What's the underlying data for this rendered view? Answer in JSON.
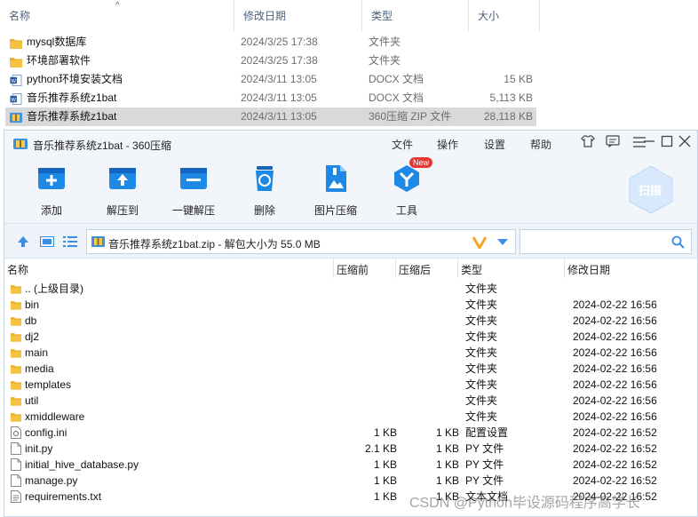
{
  "explorer": {
    "columns": {
      "name": "名称",
      "date": "修改日期",
      "type": "类型",
      "size": "大小"
    },
    "rows": [
      {
        "name": "mysql数据库",
        "date": "2024/3/25 17:38",
        "type": "文件夹",
        "size": "",
        "icon": "folder-icon"
      },
      {
        "name": "环境部署软件",
        "date": "2024/3/25 17:38",
        "type": "文件夹",
        "size": "",
        "icon": "folder-icon"
      },
      {
        "name": "python环境安装文档",
        "date": "2024/3/11 13:05",
        "type": "DOCX 文档",
        "size": "15 KB",
        "icon": "word-doc-icon"
      },
      {
        "name": "音乐推荐系统z1bat",
        "date": "2024/3/11 13:05",
        "type": "DOCX 文档",
        "size": "5,113 KB",
        "icon": "word-doc-icon"
      },
      {
        "name": "音乐推荐系统z1bat",
        "date": "2024/3/11 13:05",
        "type": "360压缩 ZIP 文件",
        "size": "28,118 KB",
        "icon": "zip-archive-icon",
        "selected": true
      }
    ]
  },
  "archiver": {
    "title": "音乐推荐系统z1bat - 360压缩",
    "menu": [
      "文件",
      "操作",
      "设置",
      "帮助"
    ],
    "toolbar": [
      {
        "label": "添加",
        "icon": "add-icon"
      },
      {
        "label": "解压到",
        "icon": "extract-to-icon"
      },
      {
        "label": "一键解压",
        "icon": "one-click-extract-icon"
      },
      {
        "label": "删除",
        "icon": "delete-icon"
      },
      {
        "label": "图片压缩",
        "icon": "image-compress-icon"
      },
      {
        "label": "工具",
        "icon": "tools-icon",
        "badge": "New"
      }
    ],
    "scan_label": "扫描",
    "address": "音乐推荐系统z1bat.zip - 解包大小为 55.0 MB",
    "search_placeholder": "",
    "columns": {
      "name": "名称",
      "compressed": "压缩前",
      "actual": "压缩后",
      "type": "类型",
      "date": "修改日期"
    },
    "files": [
      {
        "name": ".. (上级目录)",
        "c": "",
        "a": "",
        "type": "文件夹",
        "date": "",
        "icon": "folder-icon"
      },
      {
        "name": "bin",
        "c": "",
        "a": "",
        "type": "文件夹",
        "date": "2024-02-22 16:56",
        "icon": "folder-icon"
      },
      {
        "name": "db",
        "c": "",
        "a": "",
        "type": "文件夹",
        "date": "2024-02-22 16:56",
        "icon": "folder-icon"
      },
      {
        "name": "dj2",
        "c": "",
        "a": "",
        "type": "文件夹",
        "date": "2024-02-22 16:56",
        "icon": "folder-icon"
      },
      {
        "name": "main",
        "c": "",
        "a": "",
        "type": "文件夹",
        "date": "2024-02-22 16:56",
        "icon": "folder-icon"
      },
      {
        "name": "media",
        "c": "",
        "a": "",
        "type": "文件夹",
        "date": "2024-02-22 16:56",
        "icon": "folder-icon"
      },
      {
        "name": "templates",
        "c": "",
        "a": "",
        "type": "文件夹",
        "date": "2024-02-22 16:56",
        "icon": "folder-icon"
      },
      {
        "name": "util",
        "c": "",
        "a": "",
        "type": "文件夹",
        "date": "2024-02-22 16:56",
        "icon": "folder-icon"
      },
      {
        "name": "xmiddleware",
        "c": "",
        "a": "",
        "type": "文件夹",
        "date": "2024-02-22 16:56",
        "icon": "folder-icon"
      },
      {
        "name": "config.ini",
        "c": "1 KB",
        "a": "1 KB",
        "type": "配置设置",
        "date": "2024-02-22 16:52",
        "icon": "config-file-icon"
      },
      {
        "name": "init.py",
        "c": "2.1 KB",
        "a": "1 KB",
        "type": "PY 文件",
        "date": "2024-02-22 16:52",
        "icon": "file-icon"
      },
      {
        "name": "initial_hive_database.py",
        "c": "1 KB",
        "a": "1 KB",
        "type": "PY 文件",
        "date": "2024-02-22 16:52",
        "icon": "file-icon"
      },
      {
        "name": "manage.py",
        "c": "1 KB",
        "a": "1 KB",
        "type": "PY 文件",
        "date": "2024-02-22 16:52",
        "icon": "file-icon"
      },
      {
        "name": "requirements.txt",
        "c": "1 KB",
        "a": "1 KB",
        "type": "文本文档",
        "date": "2024-02-22 16:52",
        "icon": "text-file-icon"
      }
    ]
  },
  "watermark": "CSDN @Python毕设源码程序高学长",
  "colors": {
    "accent": "#1e88e5",
    "folder": "#f5c342",
    "selected": "#d9d9d9"
  }
}
